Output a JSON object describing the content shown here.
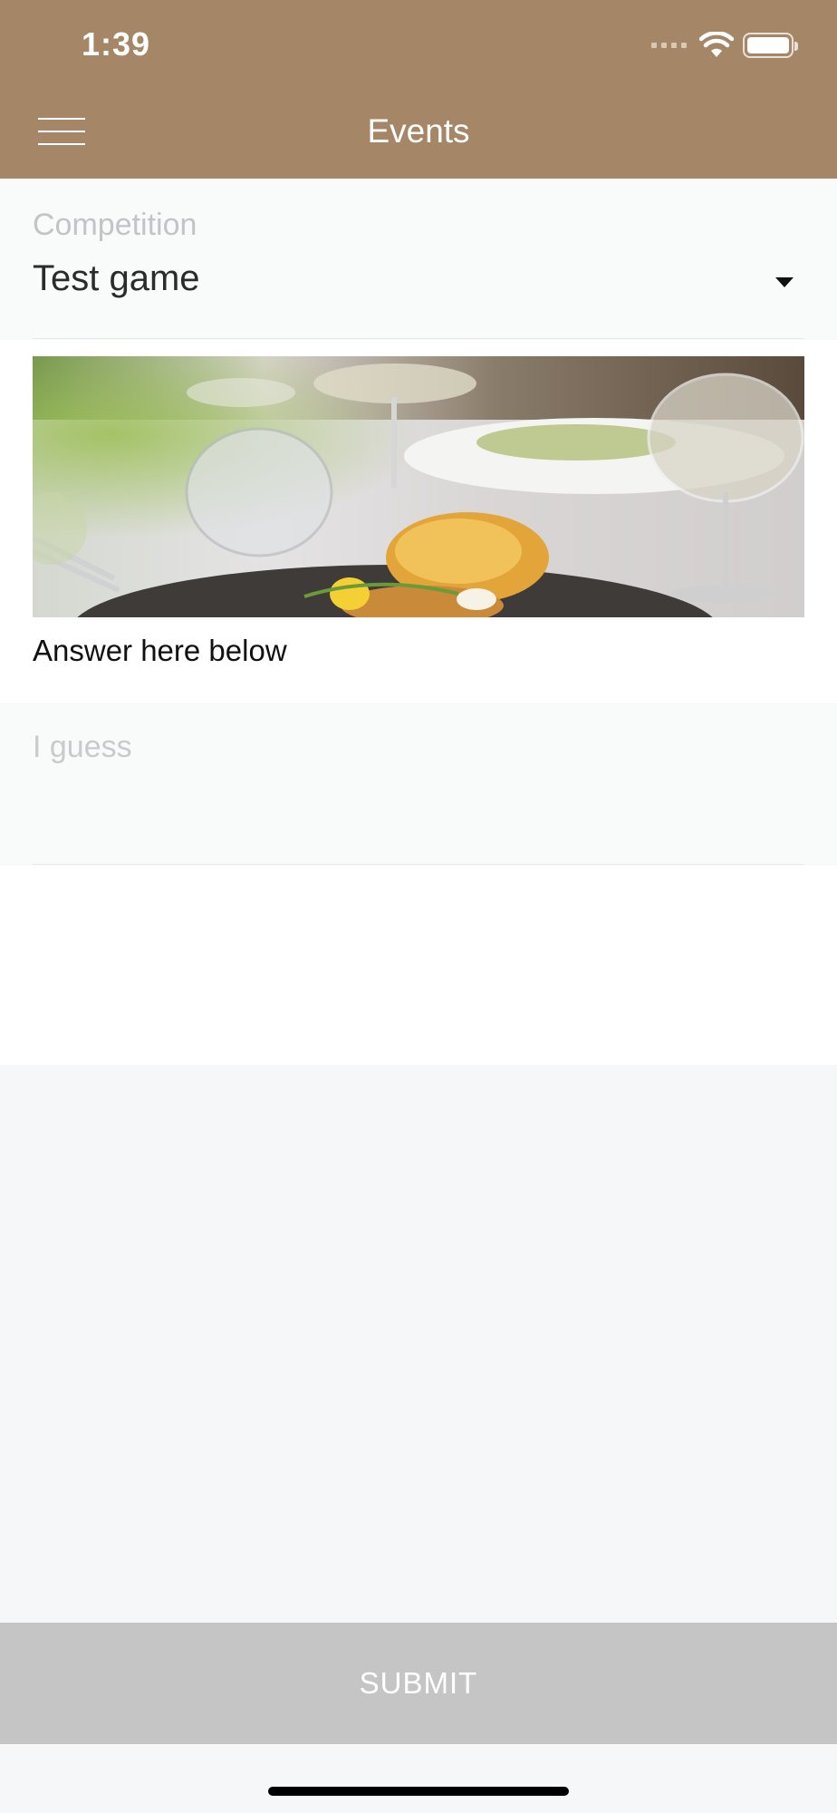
{
  "status_bar": {
    "time": "1:39"
  },
  "header": {
    "title": "Events",
    "background_color": "#a58767",
    "menu_icon": "hamburger-menu-icon"
  },
  "competition": {
    "label": "Competition",
    "selected_value": "Test game",
    "dropdown_icon": "triangle-down-icon"
  },
  "event_image": {
    "icon": "restaurant-table-photo"
  },
  "answer": {
    "prompt": "Answer here below",
    "placeholder": "I guess",
    "value": ""
  },
  "submit": {
    "label": "SUBMIT",
    "background_color": "#c5c5c6"
  }
}
